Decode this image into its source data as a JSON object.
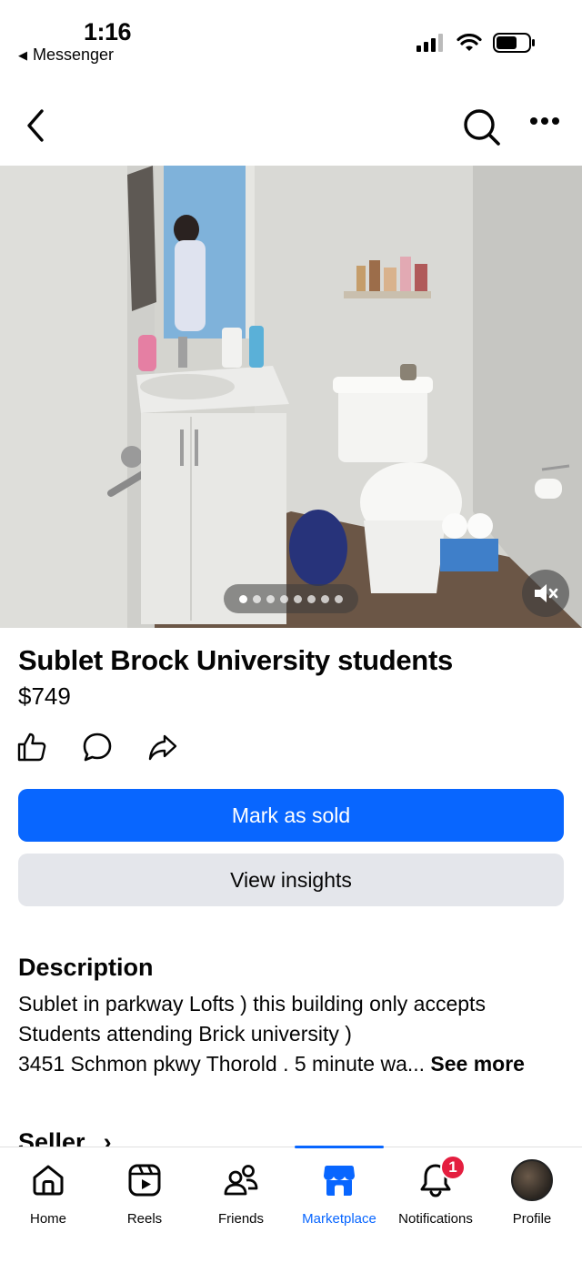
{
  "status_bar": {
    "time": "1:16",
    "back_app": "Messenger"
  },
  "listing": {
    "title": "Sublet Brock University students",
    "price": "$749",
    "photo_count": 8,
    "active_photo": 1
  },
  "buttons": {
    "mark_sold": "Mark as sold",
    "view_insights": "View insights"
  },
  "description": {
    "heading": "Description",
    "line1": "Sublet in parkway Lofts ) this building only accepts",
    "line2": "Students attending Brick university  )",
    "line3": "3451 Schmon pkwy Thorold . 5 minute wa... ",
    "see_more": "See more"
  },
  "seller": {
    "heading": "Seller"
  },
  "tabbar": {
    "home": "Home",
    "reels": "Reels",
    "friends": "Friends",
    "marketplace": "Marketplace",
    "notifications": "Notifications",
    "notifications_badge": "1",
    "profile": "Profile"
  },
  "colors": {
    "accent": "#0866ff",
    "secondary_button": "#e4e6eb",
    "badge": "#e41e3f"
  }
}
